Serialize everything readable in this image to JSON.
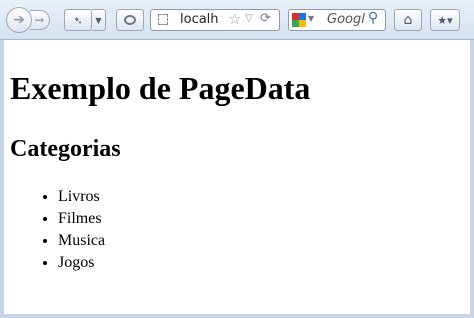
{
  "browser": {
    "url": "localh",
    "search_placeholder": "Googl",
    "icons": {
      "back": "back-arrow-icon",
      "forward": "forward-arrow-icon",
      "history": "history-icon",
      "reader": "reader-icon",
      "site": "site-identity-icon",
      "bookmark_star": "star-icon",
      "reload": "reload-icon",
      "search_engine": "google-icon",
      "search_go": "search-icon",
      "home": "home-icon",
      "bookmarks": "bookmarks-icon"
    }
  },
  "page": {
    "title": "Exemplo de PageData",
    "section_title": "Categorias",
    "categories": [
      "Livros",
      "Filmes",
      "Musica",
      "Jogos"
    ]
  }
}
